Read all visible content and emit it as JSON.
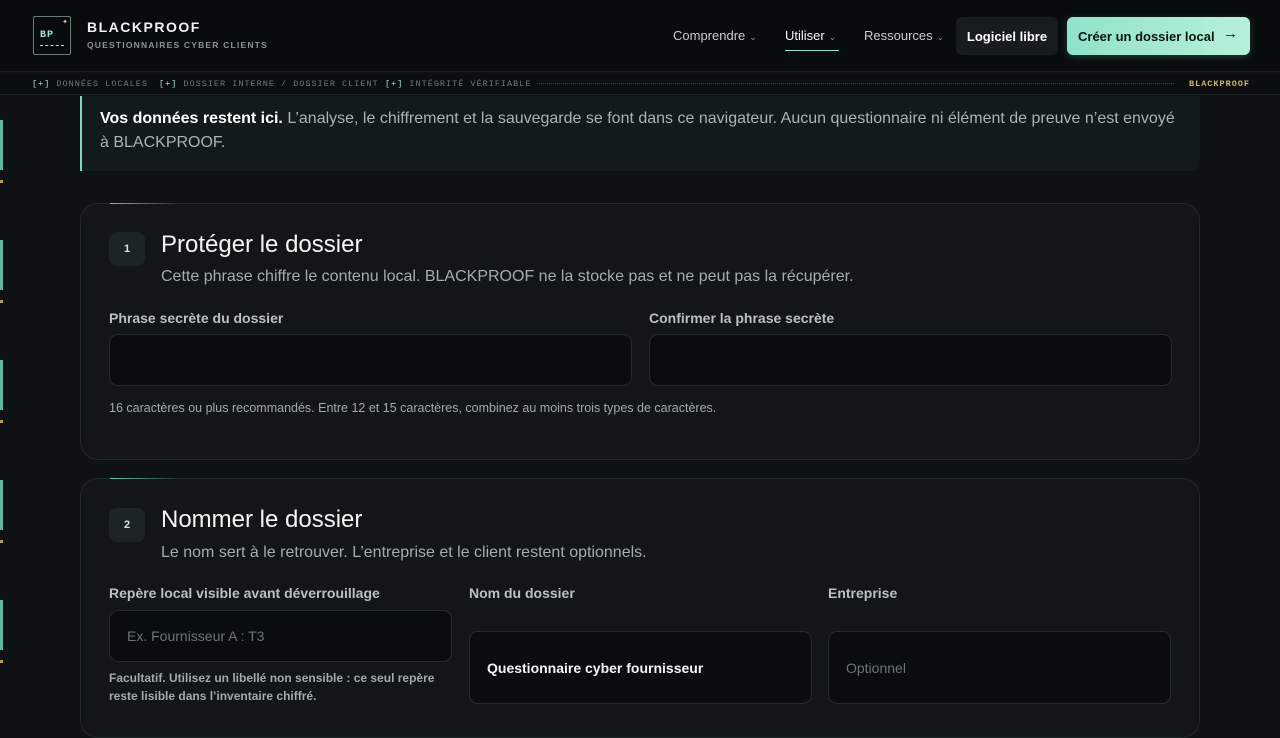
{
  "brand": {
    "logo_text": "BP",
    "name": "BLACKPROOF",
    "tagline": "QUESTIONNAIRES CYBER CLIENTS"
  },
  "nav": {
    "items": [
      {
        "label": "Comprendre",
        "has_dropdown": true
      },
      {
        "label": "Utiliser",
        "has_dropdown": true,
        "active": true
      },
      {
        "label": "Ressources",
        "has_dropdown": true
      }
    ],
    "libre_label": "Logiciel libre",
    "create_label": "Créer un dossier local",
    "create_icon": "arrow-right-icon"
  },
  "status_strip": {
    "tags": [
      {
        "marker": "[+]",
        "label": "DONNÉES LOCALES"
      },
      {
        "marker": "[+]",
        "label": "DOSSIER INTERNE / DOSSIER CLIENT"
      },
      {
        "marker": "[+]",
        "label": "INTÉGRITÉ VÉRIFIABLE"
      }
    ],
    "brand": "BLACKPROOF"
  },
  "banner": {
    "strong": "Vos données restent ici.",
    "text": " L’analyse, le chiffrement et la sauvegarde se font dans ce navigateur. Aucun questionnaire ni élément de preuve n’est envoyé à BLACKPROOF."
  },
  "section1": {
    "step": "1",
    "title": "Protéger le dossier",
    "subtitle": "Cette phrase chiffre le contenu local. BLACKPROOF ne la stocke pas et ne peut pas la récupérer.",
    "passphrase_label": "Phrase secrète du dossier",
    "passphrase_value": "",
    "confirm_label": "Confirmer la phrase secrète",
    "confirm_value": "",
    "hint": "16 caractères ou plus recommandés. Entre 12 et 15 caractères, combinez au moins trois types de caractères."
  },
  "section2": {
    "step": "2",
    "title": "Nommer le dossier",
    "subtitle": "Le nom sert à le retrouver. L’entreprise et le client restent optionnels.",
    "marker_label": "Repère local visible avant déverrouillage",
    "marker_placeholder": "Ex. Fournisseur A : T3",
    "marker_hint": "Facultatif. Utilisez un libellé non sensible : ce seul repère reste lisible dans l’inventaire chiffré.",
    "name_label": "Nom du dossier",
    "name_value": "Questionnaire cyber fournisseur",
    "company_label": "Entreprise",
    "company_placeholder": "Optionnel"
  },
  "colors": {
    "accent": "#8fe3c8",
    "accent_gold": "#d6b46a",
    "background": "#0e1213"
  }
}
